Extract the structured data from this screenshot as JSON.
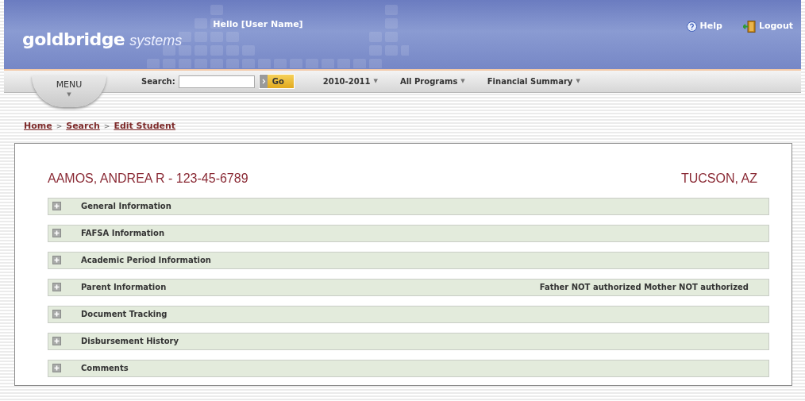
{
  "header": {
    "logo": {
      "bold": "goldbridge",
      "light": "systems"
    },
    "greeting": "Hello [User Name]",
    "links": [
      {
        "kind": "help",
        "label": "Help"
      },
      {
        "kind": "logout",
        "label": "Logout"
      }
    ]
  },
  "toolbar": {
    "menu": {
      "label": "MENU",
      "symbol": "▼"
    },
    "search": {
      "label": "Search:",
      "button": "Go"
    },
    "dropdowns": [
      {
        "label": "2010-2011",
        "caret": "▼"
      },
      {
        "label": "All Programs",
        "caret": "▼"
      },
      {
        "label": "Financial Summary",
        "caret": "▼"
      }
    ]
  },
  "breadcrumb": [
    {
      "label": "Home",
      "link": true
    },
    {
      "label": ">",
      "link": false
    },
    {
      "label": "Search",
      "link": true
    },
    {
      "label": ">",
      "link": false
    },
    {
      "label": "Edit Student",
      "link": true
    }
  ],
  "student": {
    "name": "AAMOS, ANDREA R - 123-45-6789",
    "location": "TUCSON, AZ"
  },
  "sections": [
    {
      "title": "General Information",
      "expanded": false
    },
    {
      "title": "FAFSA Information",
      "expanded": false
    },
    {
      "title": "Academic Period Information",
      "expanded": false
    },
    {
      "title": "Parent Information",
      "expanded": false,
      "note": "Father NOT authorized Mother NOT authorized"
    },
    {
      "title": "Document Tracking",
      "expanded": false
    },
    {
      "title": "Disbursement History",
      "expanded": false
    },
    {
      "title": "Comments",
      "expanded": false
    }
  ]
}
